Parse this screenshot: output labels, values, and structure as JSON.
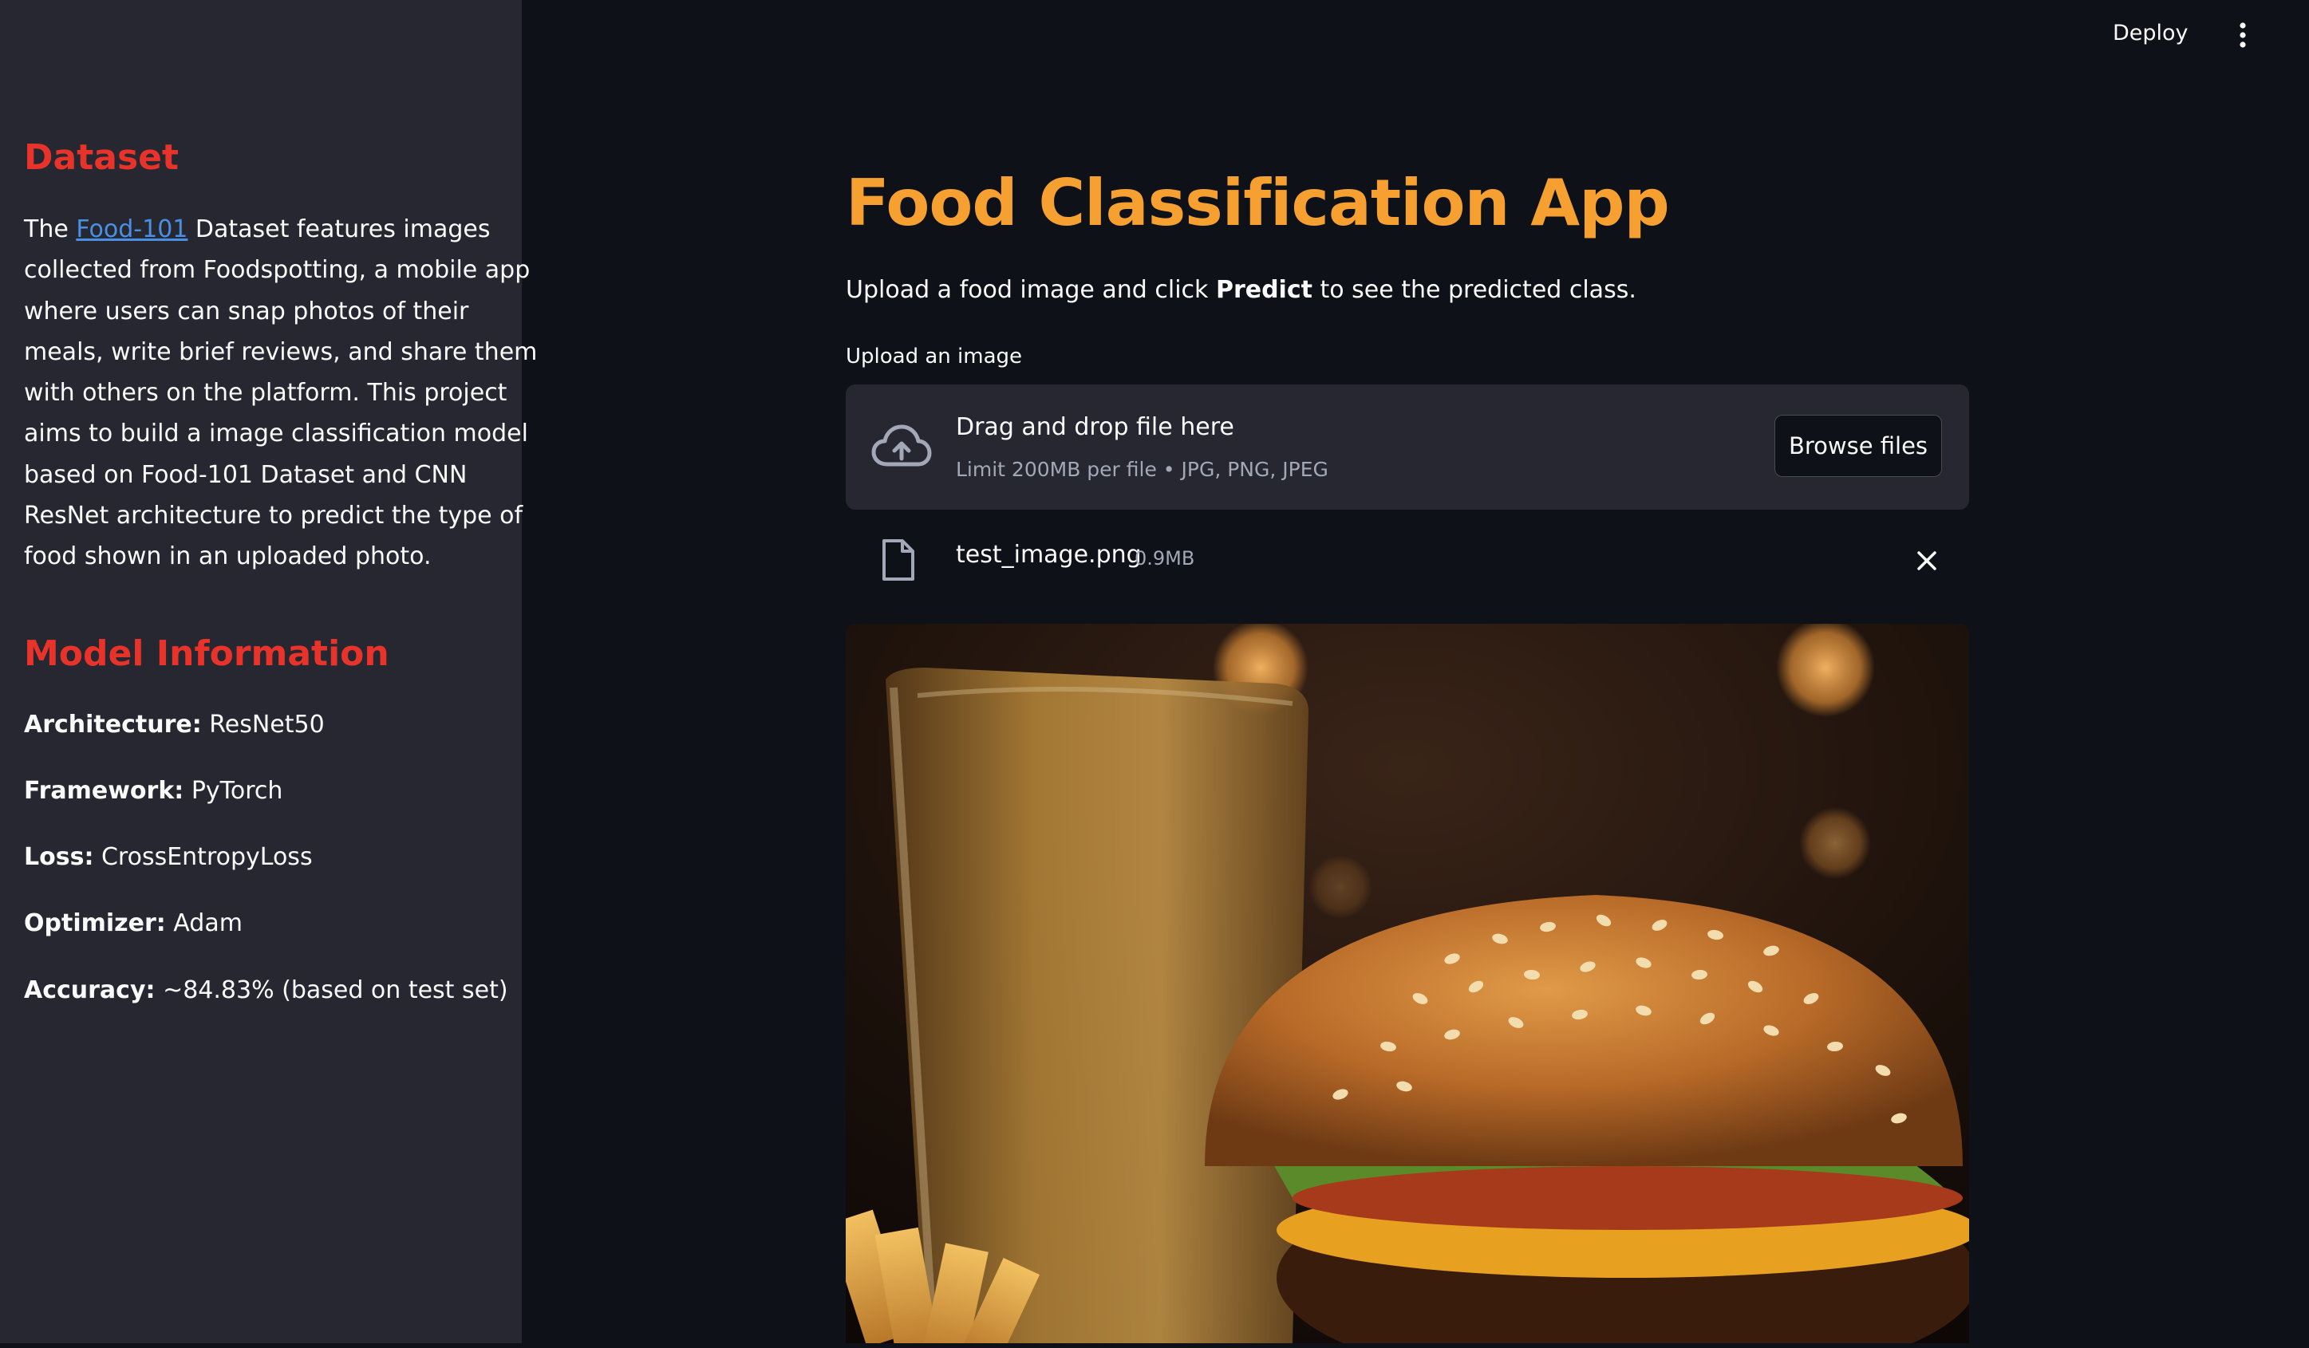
{
  "header": {
    "deploy_label": "Deploy",
    "menu_icon": "more-vertical-icon"
  },
  "sidebar": {
    "dataset_heading": "Dataset",
    "description": {
      "prefix": "The ",
      "link_text": "Food-101",
      "line1_rest": " Dataset features images",
      "lines": [
        "collected from Foodspotting, a mobile app",
        "where users can snap photos of their",
        "meals, write brief reviews, and share them",
        "with others on the platform. This project",
        "aims to build a image classification model",
        "based on Food-101 Dataset and CNN",
        "ResNet architecture to predict the type of",
        "food shown in an uploaded photo."
      ]
    },
    "model_heading": "Model Information",
    "info": [
      {
        "label": "Architecture:",
        "value": " ResNet50"
      },
      {
        "label": "Framework:",
        "value": " PyTorch"
      },
      {
        "label": "Loss:",
        "value": " CrossEntropyLoss"
      },
      {
        "label": "Optimizer:",
        "value": " Adam"
      },
      {
        "label": "Accuracy:",
        "value": " ~84.83% (based on test set)"
      }
    ]
  },
  "main": {
    "title": "Food Classification App",
    "subtitle": {
      "before": "Upload a food image and click ",
      "bold": "Predict",
      "after": " to see the predicted class."
    },
    "upload_label": "Upload an image",
    "dropzone": {
      "main_text": "Drag and drop file here",
      "sub_text": "Limit 200MB per file • JPG, PNG, JPEG",
      "browse_label": "Browse files",
      "icon": "cloud-upload-icon"
    },
    "file": {
      "name": "test_image.png",
      "size": "0.9MB",
      "icon": "file-icon",
      "remove_icon": "close-icon"
    },
    "preview": {
      "subject": "burger-with-fries-and-drink"
    }
  },
  "colors": {
    "background": "#0e1117",
    "sidebar": "#262730",
    "heading_red": "#e8332b",
    "title_orange": "#f5a030",
    "link_blue": "#4a90e2",
    "muted_text": "#a3a8b8"
  }
}
